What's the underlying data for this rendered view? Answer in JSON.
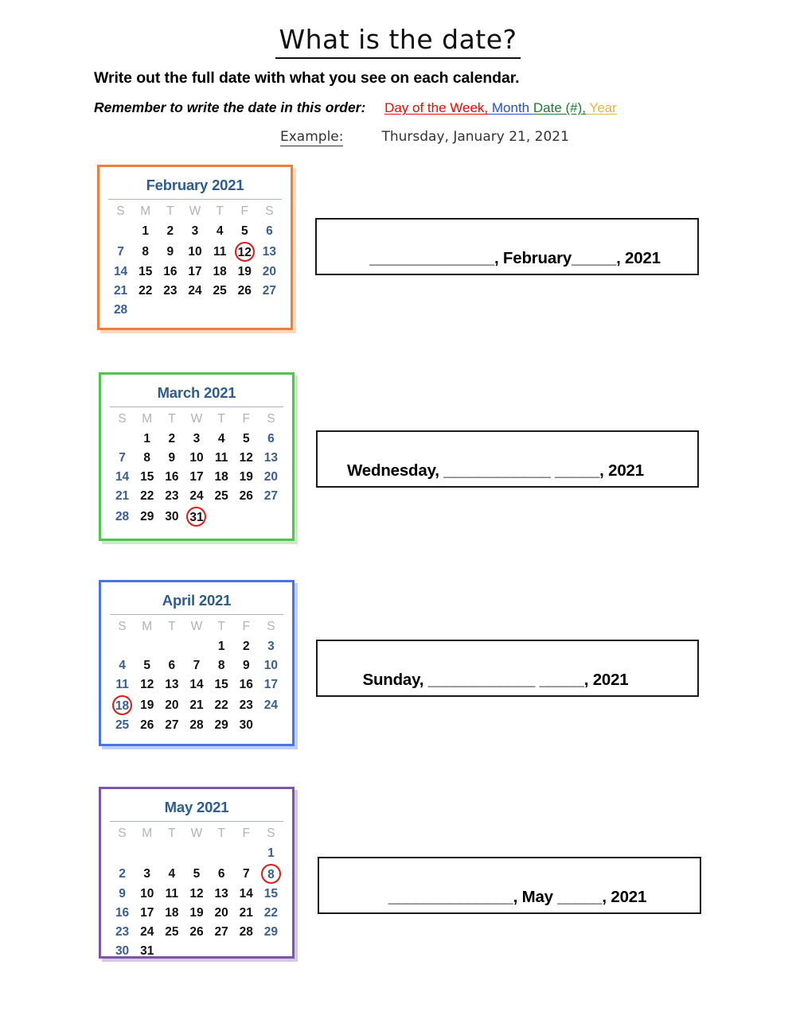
{
  "header": {
    "title": "What is the date?",
    "instruction": "Write out the full date with what you see on each calendar.",
    "remember_label": "Remember to write the date in this order:",
    "order_parts": {
      "day": "Day of the Week",
      "comma1": ",",
      "month": " Month ",
      "date": " Date (#)",
      "comma2": ",",
      "year": "  Year"
    },
    "example_label": "Example:",
    "example_value": "Thursday, January 21, 2021"
  },
  "colors": {
    "day_of_week": "#FF0000",
    "month": "#1F4FD8",
    "date_num": "#1E7A34",
    "year": "#E8B63C",
    "month_title": "#2E5C8C",
    "weekend_day": "#3C5E8E",
    "weekday": "#111111",
    "weekday_header": "#B3B3B3",
    "circle": "#E01B1B",
    "border_february": "#F07F3C",
    "border_march": "#4FC64F",
    "border_april": "#4A73E8",
    "border_may": "#7E56A8"
  },
  "weekday_headers": [
    "S",
    "M",
    "T",
    "W",
    "T",
    "F",
    "S"
  ],
  "calendars": [
    {
      "id": "february",
      "title": "February 2021",
      "circled_day": 12,
      "weeks": [
        [
          "",
          "1",
          "2",
          "3",
          "4",
          "5",
          "6"
        ],
        [
          "7",
          "8",
          "9",
          "10",
          "11",
          "12",
          "13"
        ],
        [
          "14",
          "15",
          "16",
          "17",
          "18",
          "19",
          "20"
        ],
        [
          "21",
          "22",
          "23",
          "24",
          "25",
          "26",
          "27"
        ],
        [
          "28",
          "",
          "",
          "",
          "",
          "",
          ""
        ]
      ]
    },
    {
      "id": "march",
      "title": "March 2021",
      "circled_day": 31,
      "weeks": [
        [
          "",
          "1",
          "2",
          "3",
          "4",
          "5",
          "6"
        ],
        [
          "7",
          "8",
          "9",
          "10",
          "11",
          "12",
          "13"
        ],
        [
          "14",
          "15",
          "16",
          "17",
          "18",
          "19",
          "20"
        ],
        [
          "21",
          "22",
          "23",
          "24",
          "25",
          "26",
          "27"
        ],
        [
          "28",
          "29",
          "30",
          "31",
          "",
          "",
          ""
        ]
      ]
    },
    {
      "id": "april",
      "title": "April 2021",
      "circled_day": 18,
      "weeks": [
        [
          "",
          "",
          "",
          "",
          "1",
          "2",
          "3"
        ],
        [
          "4",
          "5",
          "6",
          "7",
          "8",
          "9",
          "10"
        ],
        [
          "11",
          "12",
          "13",
          "14",
          "15",
          "16",
          "17"
        ],
        [
          "18",
          "19",
          "20",
          "21",
          "22",
          "23",
          "24"
        ],
        [
          "25",
          "26",
          "27",
          "28",
          "29",
          "30",
          ""
        ]
      ]
    },
    {
      "id": "may",
      "title": "May 2021",
      "circled_day": 8,
      "weeks": [
        [
          "",
          "",
          "",
          "",
          "",
          "",
          "1"
        ],
        [
          "2",
          "3",
          "4",
          "5",
          "6",
          "7",
          "8"
        ],
        [
          "9",
          "10",
          "11",
          "12",
          "13",
          "14",
          "15"
        ],
        [
          "16",
          "17",
          "18",
          "19",
          "20",
          "21",
          "22"
        ],
        [
          "23",
          "24",
          "25",
          "26",
          "27",
          "28",
          "29"
        ],
        [
          "30",
          "31",
          "",
          "",
          "",
          "",
          ""
        ]
      ]
    }
  ],
  "answers": [
    {
      "id": "answer-february",
      "text": "______________, February_____, 2021"
    },
    {
      "id": "answer-march",
      "text": "Wednesday, ____________ _____, 2021"
    },
    {
      "id": "answer-april",
      "text": "Sunday, ____________ _____, 2021"
    },
    {
      "id": "answer-may",
      "text": "______________, May _____, 2021"
    }
  ]
}
